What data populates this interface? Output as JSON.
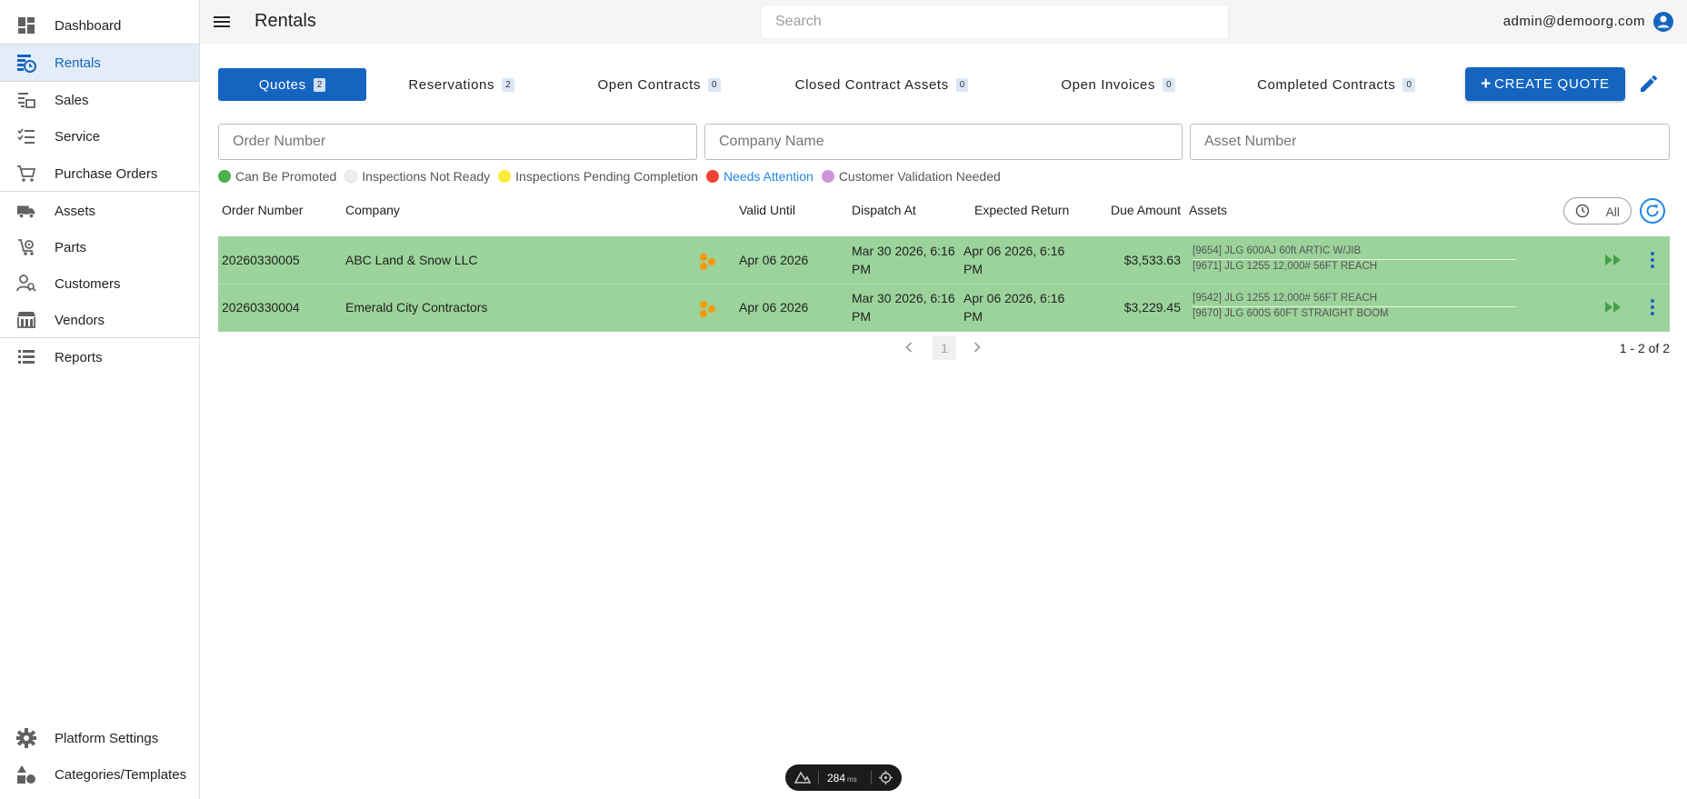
{
  "sidebar": {
    "top_items": [
      {
        "label": "Dashboard",
        "icon": "dashboard-icon"
      },
      {
        "label": "Rentals",
        "icon": "rentals-icon",
        "active": true
      },
      {
        "label": "Sales",
        "icon": "sales-icon"
      },
      {
        "label": "Service",
        "icon": "service-icon"
      },
      {
        "label": "Purchase Orders",
        "icon": "cart-icon"
      },
      {
        "label": "Assets",
        "icon": "truck-icon"
      },
      {
        "label": "Parts",
        "icon": "parts-icon"
      },
      {
        "label": "Customers",
        "icon": "customers-icon"
      },
      {
        "label": "Vendors",
        "icon": "vendors-icon"
      },
      {
        "label": "Reports",
        "icon": "reports-icon"
      }
    ],
    "bottom_items": [
      {
        "label": "Platform Settings",
        "icon": "gear-icon"
      },
      {
        "label": "Categories/Templates",
        "icon": "categories-icon"
      }
    ]
  },
  "header": {
    "title": "Rentals",
    "search_placeholder": "Search",
    "user_email": "admin@demoorg.com"
  },
  "tabs": [
    {
      "label": "Quotes",
      "count": "2",
      "active": true
    },
    {
      "label": "Reservations",
      "count": "2"
    },
    {
      "label": "Open Contracts",
      "count": "0"
    },
    {
      "label": "Closed Contract Assets",
      "count": "0"
    },
    {
      "label": "Open Invoices",
      "count": "0"
    },
    {
      "label": "Completed Contracts",
      "count": "0"
    }
  ],
  "create_button_label": "CREATE QUOTE",
  "filters": {
    "order_number_placeholder": "Order Number",
    "company_name_placeholder": "Company Name",
    "asset_number_placeholder": "Asset Number"
  },
  "legend": [
    {
      "label": "Can Be Promoted",
      "color": "#4caf50"
    },
    {
      "label": "Inspections Not Ready",
      "color": "#eeeeee"
    },
    {
      "label": "Inspections Pending Completion",
      "color": "#ffeb3b"
    },
    {
      "label": "Needs Attention",
      "color": "#f44336"
    },
    {
      "label": "Customer Validation Needed",
      "color": "#ce93d8"
    }
  ],
  "table": {
    "headers": {
      "order_number": "Order Number",
      "company": "Company",
      "valid_until": "Valid Until",
      "dispatch_at": "Dispatch At",
      "expected_return": "Expected Return",
      "due_amount": "Due Amount",
      "assets": "Assets"
    },
    "filter_toggle_label": "All",
    "rows": [
      {
        "order_number": "20260330005",
        "company": "ABC Land & Snow LLC",
        "valid_until": "Apr 06 2026",
        "dispatch_at": "Mar 30 2026, 6:16 PM",
        "expected_return": "Apr 06 2026, 6:16 PM",
        "due_amount": "$3,533.63",
        "assets": [
          "[9654] JLG 600AJ 60ft ARTIC W/JIB",
          "[9671] JLG 1255 12,000# 56FT REACH"
        ]
      },
      {
        "order_number": "20260330004",
        "company": "Emerald City Contractors",
        "valid_until": "Apr 06 2026",
        "dispatch_at": "Mar 30 2026, 6:16 PM",
        "expected_return": "Apr 06 2026, 6:16 PM",
        "due_amount": "$3,229.45",
        "assets": [
          "[9542] JLG 1255 12,000# 56FT REACH",
          "[9670] JLG 600S 60FT STRAIGHT BOOM"
        ]
      }
    ]
  },
  "pagination": {
    "current_page": "1",
    "range_label": "1 - 2 of 2"
  },
  "perf_badge": {
    "value": "284",
    "unit": "ms"
  },
  "colors": {
    "primary": "#1565c0",
    "row_highlight": "#9bd39a",
    "status_orange": "#ff9800",
    "promote_green": "#43a047"
  }
}
